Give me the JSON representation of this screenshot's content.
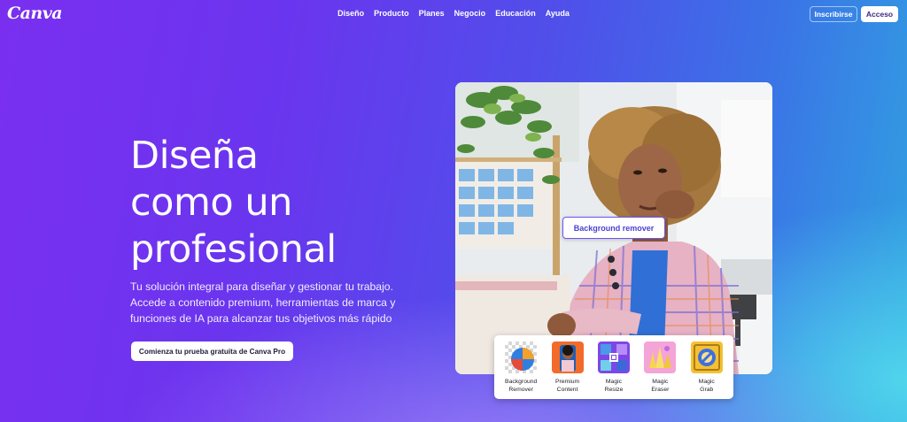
{
  "brand": {
    "logo": "Canva"
  },
  "nav": {
    "items": [
      "Diseño",
      "Producto",
      "Planes",
      "Negocio",
      "Educación",
      "Ayuda"
    ],
    "signup": "Inscribirse",
    "login": "Acceso"
  },
  "hero": {
    "headline_lines": [
      "Diseña",
      "como un",
      "profesional"
    ],
    "subtitle_lines": [
      "Tu solución integral para diseñar y gestionar tu trabajo.",
      "Accede a contenido premium, herramientas de marca y",
      "funciones de IA para alcanzar tus objetivos más rápido"
    ],
    "cta": "Comienza tu prueba gratuita de Canva Pro"
  },
  "photo": {
    "tag": "Background remover"
  },
  "tools": [
    {
      "line1": "Background",
      "line2": "Remover",
      "icon": "background-remover-icon"
    },
    {
      "line1": "Premium",
      "line2": "Content",
      "icon": "premium-content-icon"
    },
    {
      "line1": "Magic",
      "line2": "Resize",
      "icon": "magic-resize-icon"
    },
    {
      "line1": "Magic",
      "line2": "Eraser",
      "icon": "magic-eraser-icon"
    },
    {
      "line1": "Magic",
      "line2": "Grab",
      "icon": "magic-grab-icon"
    }
  ],
  "colors": {
    "gradient_start": "#7a2ff0",
    "gradient_end": "#31a3e1",
    "tag_border": "#6a57f0"
  }
}
